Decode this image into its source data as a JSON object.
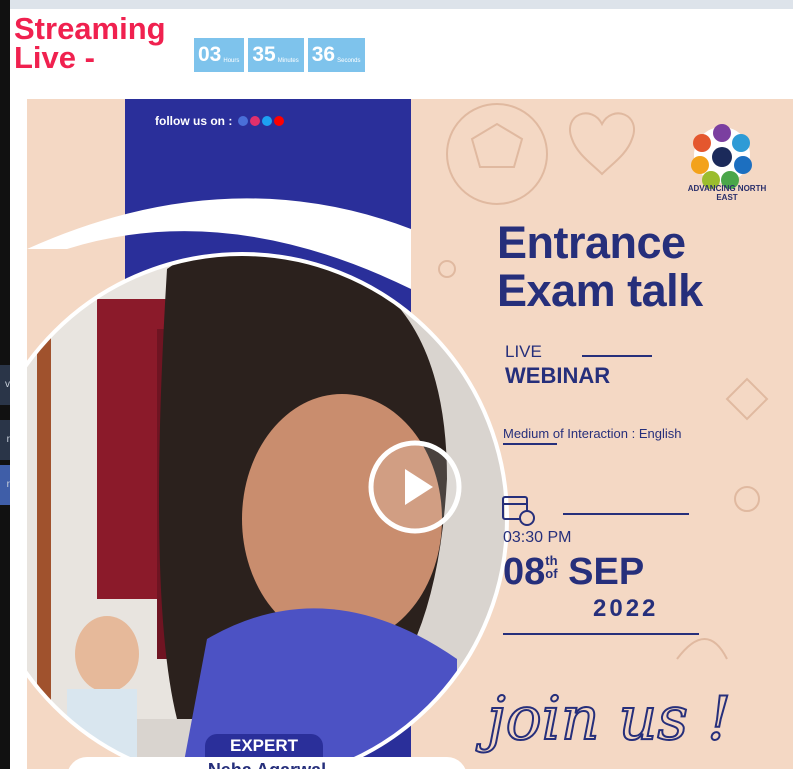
{
  "header": {
    "label": "Streaming Live -",
    "countdown": [
      {
        "value": "03",
        "unit": "Hours"
      },
      {
        "value": "35",
        "unit": "Minutes"
      },
      {
        "value": "36",
        "unit": "Seconds"
      }
    ]
  },
  "side": {
    "chip1": "v",
    "chip2": "r",
    "chip3": "r"
  },
  "poster": {
    "follow_text": "follow us on :",
    "social_icons": [
      "facebook-icon",
      "instagram-icon",
      "twitter-icon",
      "youtube-icon"
    ],
    "logo_text": "ADVANCING NORTH EAST",
    "title_line1": "Entrance",
    "title_line2": "Exam talk",
    "live": "LIVE",
    "webinar": "WEBINAR",
    "medium": "Medium of Interaction : English",
    "time": "03:30 PM",
    "date_day": "08",
    "date_sup": "th",
    "date_of": "of",
    "date_month": "SEP",
    "year": "2022",
    "join": "join us !",
    "expert_badge": "EXPERT",
    "expert_name": "Neha Agarwal"
  },
  "colors": {
    "accent_red": "#f0214f",
    "timer_blue": "#7ec3ec",
    "poster_bg": "#f4d8c4",
    "navy": "#262f7b",
    "panel_blue": "#2a2f9a"
  }
}
